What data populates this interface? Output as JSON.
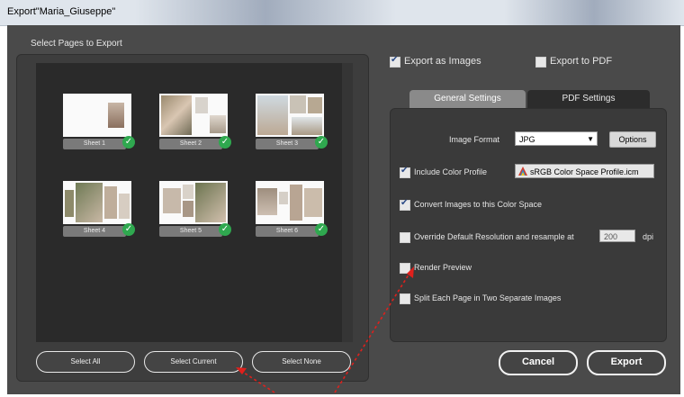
{
  "window": {
    "title": "Export\"Maria_Giuseppe\""
  },
  "left": {
    "section_label": "Select Pages to Export",
    "sheets": [
      {
        "label": "Sheet 1",
        "selected": true
      },
      {
        "label": "Sheet 2",
        "selected": true
      },
      {
        "label": "Sheet 3",
        "selected": true
      },
      {
        "label": "Sheet 4",
        "selected": true
      },
      {
        "label": "Sheet 5",
        "selected": true
      },
      {
        "label": "Sheet 6",
        "selected": true
      }
    ],
    "buttons": {
      "select_all": "Select All",
      "select_current": "Select Current",
      "select_none": "Select None"
    }
  },
  "export_mode": {
    "images_label": "Export as Images",
    "images_checked": true,
    "pdf_label": "Export to PDF",
    "pdf_checked": false
  },
  "tabs": [
    {
      "label": "General Settings",
      "active": true
    },
    {
      "label": "PDF Settings",
      "active": false
    }
  ],
  "settings": {
    "image_format_label": "Image Format",
    "image_format_value": "JPG",
    "options_button": "Options",
    "include_color_profile_label": "Include Color Profile",
    "include_color_profile_checked": true,
    "color_profile_value": "sRGB Color Space Profile.icm",
    "convert_images_label": "Convert Images to this Color Space",
    "convert_images_checked": true,
    "override_resolution_label": "Override Default Resolution and resample at",
    "override_resolution_checked": false,
    "dpi_value": "200",
    "dpi_unit": "dpi",
    "render_preview_label": "Render Preview",
    "render_preview_checked": false,
    "split_pages_label": "Split Each Page in Two Separate Images",
    "split_pages_checked": false
  },
  "footer": {
    "cancel": "Cancel",
    "export": "Export"
  },
  "colors": {
    "dialog_bg": "#4a4a4a",
    "panel_bg": "#3d3d3d",
    "check_green": "#2fa84f",
    "annotation_red": "#e0201c"
  },
  "icons": {
    "check": "check-icon",
    "profile": "color-profile-icon",
    "dropdown": "chevron-down-icon"
  }
}
